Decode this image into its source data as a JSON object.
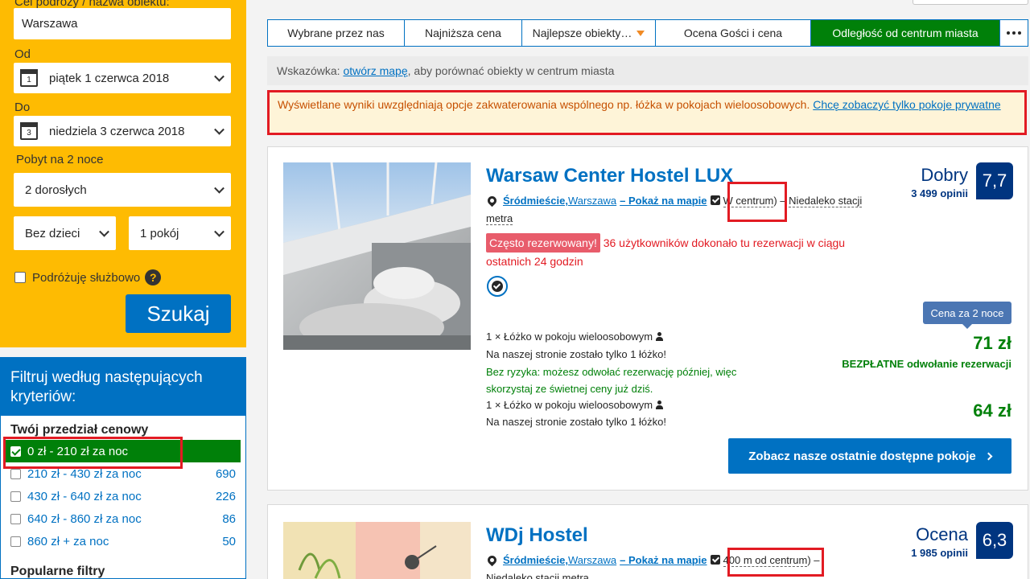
{
  "search": {
    "destination_label": "Cel podróży / nazwa obiektu:",
    "destination_value": "Warszawa",
    "from_label": "Od",
    "checkin_day": "1",
    "checkin_value": "piątek 1 czerwca 2018",
    "to_label": "Do",
    "checkout_day": "3",
    "checkout_value": "niedziela 3 czerwca 2018",
    "stay_label": "Pobyt na 2 noce",
    "adults_value": "2 dorosłych",
    "children_value": "Bez dzieci",
    "rooms_value": "1 pokój",
    "business_label": "Podróżuję służbowo",
    "help_icon_text": "?",
    "search_button": "Szukaj"
  },
  "filters": {
    "title": "Filtruj według następujących kryteriów:",
    "price_section": "Twój przedział cenowy",
    "price_ranges": [
      {
        "label": "0 zł - 210 zł za noc",
        "count": "",
        "checked": true
      },
      {
        "label": "210 zł - 430 zł za noc",
        "count": "690",
        "checked": false
      },
      {
        "label": "430 zł - 640 zł za noc",
        "count": "226",
        "checked": false
      },
      {
        "label": "640 zł - 860 zł za noc",
        "count": "86",
        "checked": false
      },
      {
        "label": "860 zł + za noc",
        "count": "50",
        "checked": false
      }
    ],
    "popular_section": "Popularne filtry"
  },
  "sort_tabs": [
    {
      "label": "Wybrane przez nas",
      "active": false
    },
    {
      "label": "Najniższa cena",
      "active": false
    },
    {
      "label": "Najlepsze obiekty…",
      "active": false,
      "has_dropdown": true
    },
    {
      "label": "Ocena Gości i cena",
      "active": false
    },
    {
      "label": "Odległość od centrum miasta",
      "active": true
    }
  ],
  "hint": {
    "prefix": "Wskazówka: ",
    "link": "otwórz mapę",
    "suffix": ", aby porównać obiekty w centrum miasta"
  },
  "warning": {
    "text": "Wyświetlane wyniki uwzględniają opcje zakwaterowania wspólnego np. łóżka w pokojach wieloosobowych. ",
    "link": "Chcę zobaczyć tylko pokoje prywatne"
  },
  "properties": [
    {
      "name": "Warsaw Center Hostel LUX",
      "district": "Śródmieście,",
      "city": "Warszawa",
      "map_link": "– Pokaż na mapie",
      "distance": "W centrum",
      "distance_suffix": ") – ",
      "transit": "Niedaleko stacji",
      "transit_2": "metra",
      "rating_word": "Dobry",
      "reviews": "3 499 opinii",
      "score": "7,7",
      "badge": "Często rezerwowany!",
      "booking_note_1": " 36 użytkowników dokonało tu rezerwacji w ciągu",
      "booking_note_2": "ostatnich 24 godzin",
      "room_1": "1 ×  Łóżko w pokoju wieloosobowym",
      "left_1": "Na naszej stronie zostało tylko 1 łóżko!",
      "risk_free": "Bez ryzyka: możesz odwołać rezerwację później, więc skorzystaj ze świetnej ceny już dziś.",
      "room_2": "1 ×  Łóżko w pokoju wieloosobowym",
      "left_2": "Na naszej stronie zostało tylko 1 łóżko!",
      "price_tag": "Cena za 2 noce",
      "price_1": "71 zł",
      "free_cancel": "BEZPŁATNE odwołanie rezerwacji",
      "price_2": "64 zł",
      "cta": "Zobacz nasze ostatnie dostępne pokoje"
    },
    {
      "name": "WDj Hostel",
      "district": "Śródmieście,",
      "city": "Warszawa",
      "map_link": "– Pokaż na mapie",
      "distance": "400 m od centrum",
      "distance_suffix": ") –",
      "transit": "Niedaleko stacji metra",
      "rating_word": "Ocena",
      "reviews": "1 985 opinii",
      "score": "6,3"
    }
  ],
  "colors": {
    "booking_yellow": "#febb02",
    "booking_blue": "#0071c2",
    "booking_dark_blue": "#003580",
    "active_green": "#008009",
    "highlight_red": "#e21b23"
  }
}
